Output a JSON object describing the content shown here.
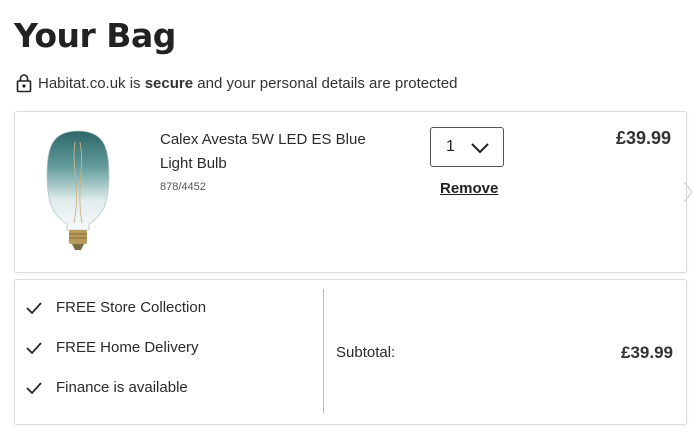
{
  "page": {
    "title": "Your Bag"
  },
  "security": {
    "prefix": "Habitat.co.uk is ",
    "emphasis": "secure",
    "suffix": " and your personal details are protected",
    "icon": "lock-icon"
  },
  "item": {
    "name": "Calex Avesta 5W LED ES Blue Light Bulb",
    "sku": "878/4452",
    "quantity": "1",
    "remove_label": "Remove",
    "price": "£39.99",
    "image": "light-bulb-image"
  },
  "benefits": [
    {
      "label": "FREE Store Collection",
      "icon": "check-icon"
    },
    {
      "label": "FREE Home Delivery",
      "icon": "check-icon"
    },
    {
      "label": "Finance is available",
      "icon": "check-icon"
    }
  ],
  "summary": {
    "subtotal_label": "Subtotal:",
    "subtotal_value": "£39.99"
  }
}
